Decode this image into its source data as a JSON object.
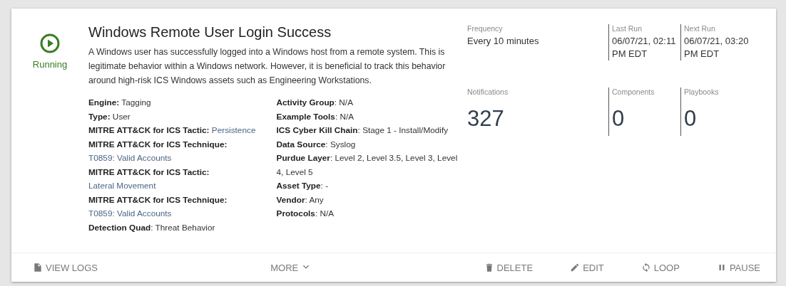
{
  "status": {
    "running": true,
    "label": "Running"
  },
  "title": "Windows Remote User Login Success",
  "description": "A Windows user has successfully logged into a Windows host from a remote system. This is legitimate behavior within a Windows network. However, it is beneficial to track this behavior around high-risk ICS Windows assets such as Engineering Workstations.",
  "details_left": [
    {
      "text": "**Engine:** Tagging"
    },
    {
      "text": "**Type:** User"
    },
    {
      "text": "**MITRE ATT&CK for ICS Tactic:**",
      "link": "Persistence"
    },
    {
      "text": "**MITRE ATT&CK for ICS Technique:**",
      "link": "T0859: Valid Accounts"
    },
    {
      "text": "**MITRE ATT&CK for ICS Tactic:**",
      "link": "Lateral Movement"
    },
    {
      "text": "**MITRE ATT&CK for ICS Technique:**",
      "link": "T0859: Valid Accounts"
    },
    {
      "text": "**Detection Quad**: Threat Behavior"
    }
  ],
  "details_right": [
    {
      "text": "**Activity Group**: N/A"
    },
    {
      "text": "**Example Tools**: N/A"
    },
    {
      "text": "**ICS Cyber Kill Chain**: Stage 1 - Install/Modify"
    },
    {
      "text": "**Data Source**: Syslog"
    },
    {
      "text": "**Purdue Layer**: Level 2, Level 3.5, Level 3, Level 4, Level 5"
    },
    {
      "text": "**Asset Type**: -"
    },
    {
      "text": "**Vendor**: Any"
    },
    {
      "text": "**Protocols**: N/A"
    }
  ],
  "schedule": [
    {
      "label": "Frequency",
      "value": "Every 10 minutes"
    },
    {
      "label": "Last Run",
      "value": "06/07/21, 02:11 PM EDT"
    },
    {
      "label": "Next Run",
      "value": "06/07/21, 03:20 PM EDT"
    }
  ],
  "counts": [
    {
      "label": "Notifications",
      "value": "327"
    },
    {
      "label": "Components",
      "value": "0"
    },
    {
      "label": "Playbooks",
      "value": "0"
    }
  ],
  "actions": [
    {
      "label": "VIEW LOGS"
    },
    {
      "label": "MORE"
    },
    {
      "label": "DELETE"
    },
    {
      "label": "EDIT"
    },
    {
      "label": "LOOP"
    },
    {
      "label": "PAUSE"
    }
  ]
}
